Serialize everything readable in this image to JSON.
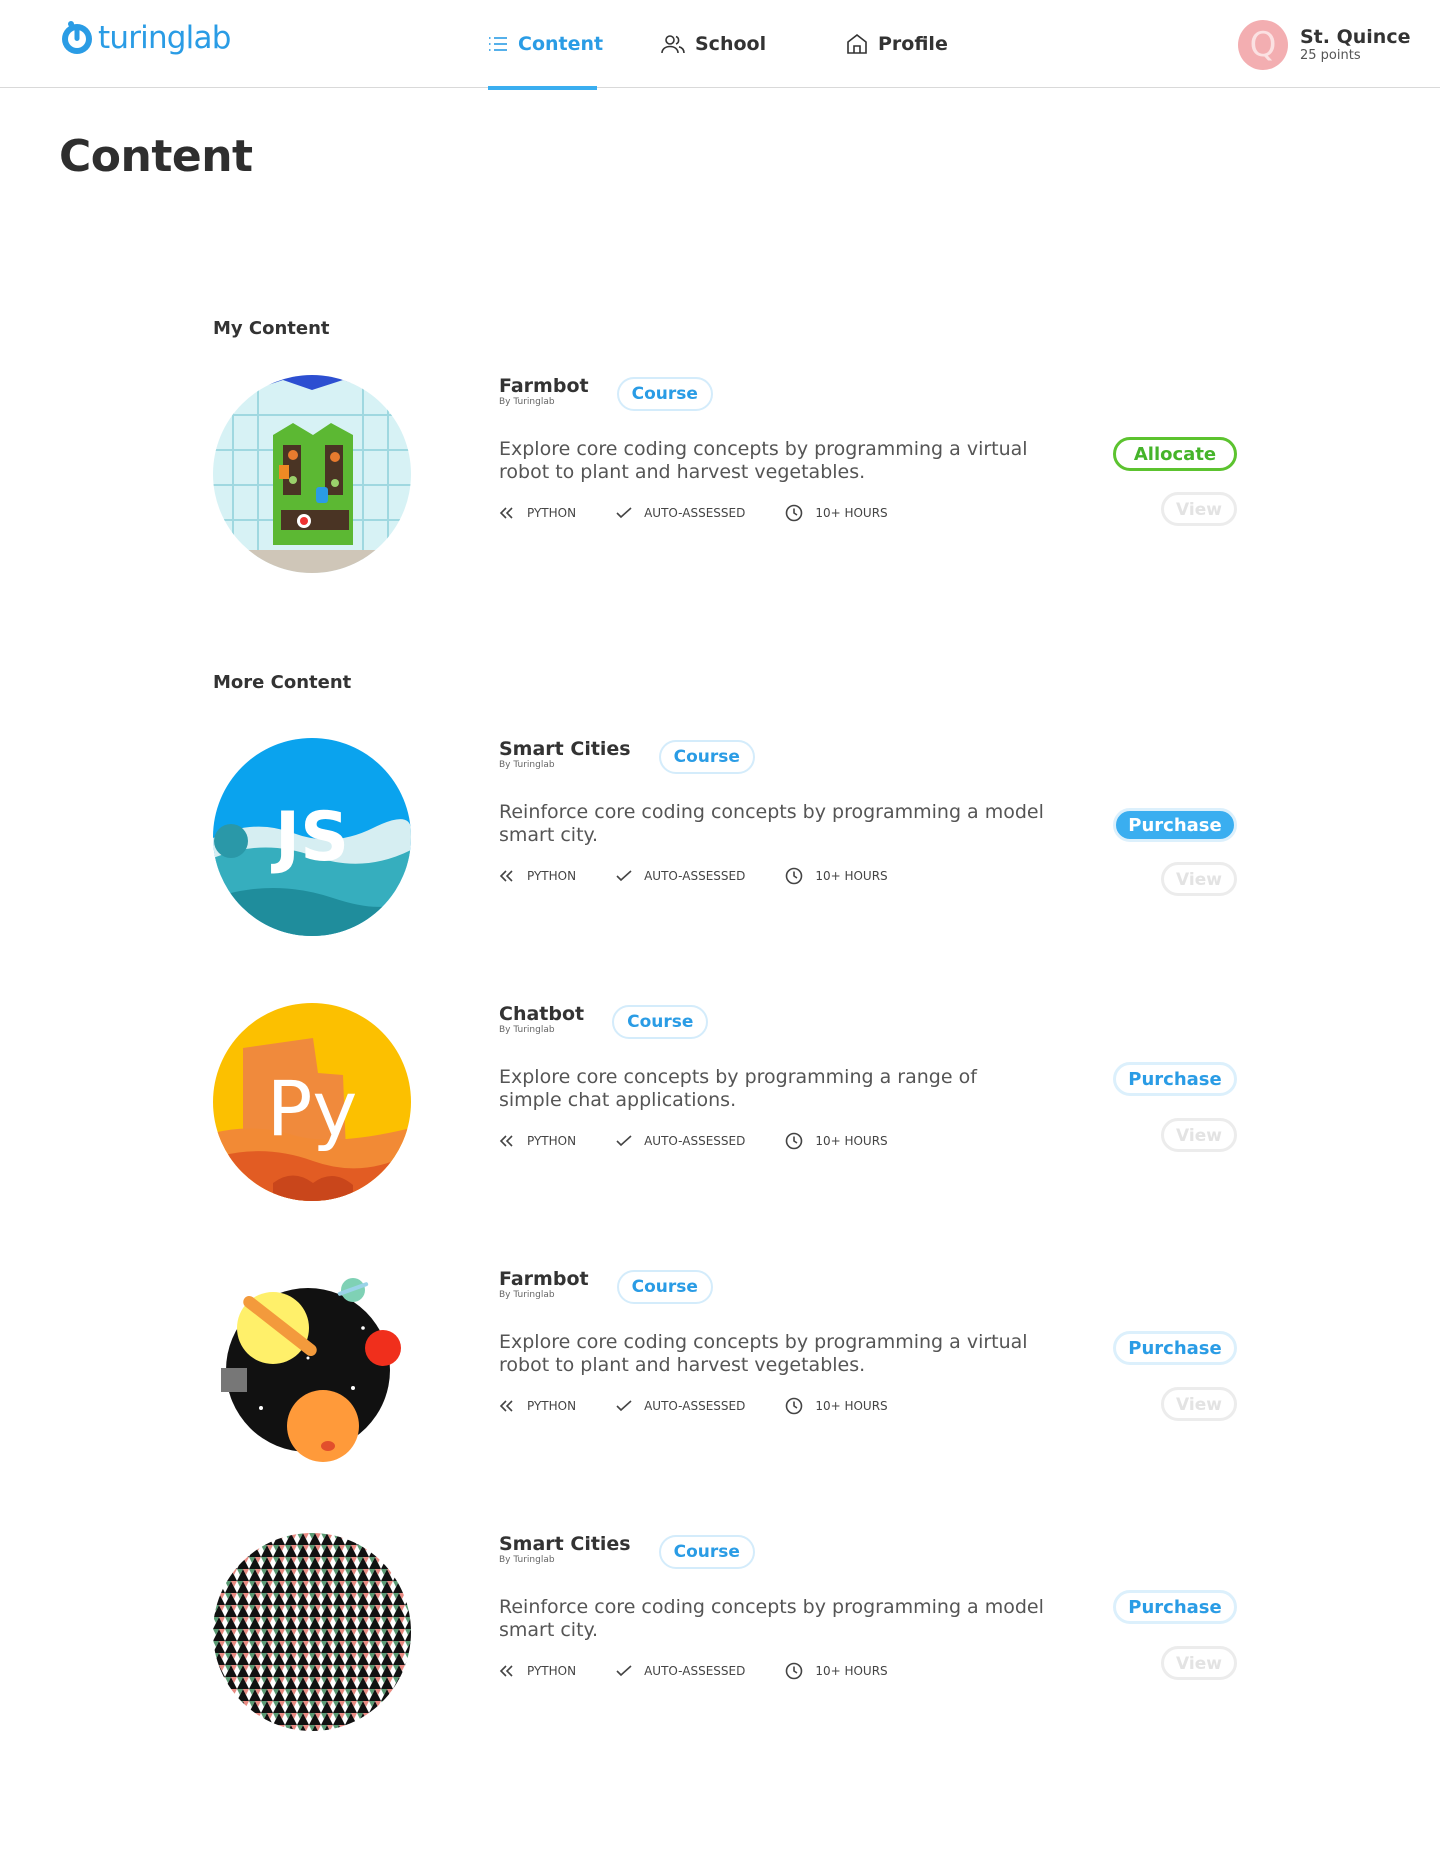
{
  "brand": {
    "name": "turinglab",
    "color": "#2a9ce5"
  },
  "nav": {
    "items": [
      {
        "label": "Content",
        "icon": "list-icon",
        "active": true
      },
      {
        "label": "School",
        "icon": "users-icon",
        "active": false
      },
      {
        "label": "Profile",
        "icon": "home-icon",
        "active": false
      }
    ]
  },
  "user": {
    "initial": "Q",
    "name": "St. Quince",
    "points": "25 points"
  },
  "page": {
    "title": "Content"
  },
  "sections": {
    "my_content": "My Content",
    "more_content": "More Content"
  },
  "cards": [
    {
      "title": "Farmbot",
      "by": "By Turinglab",
      "badge": "Course",
      "description": "Explore core coding concepts by programming a virtual robot to plant and harvest vegetables.",
      "meta": [
        "PYTHON",
        "AUTO-ASSESSED",
        "10+ HOURS"
      ],
      "primary_action": "Allocate",
      "secondary_action": "View",
      "thumb": "greenhouse"
    },
    {
      "title": "Smart Cities",
      "by": "By Turinglab",
      "badge": "Course",
      "description": "Reinforce core coding concepts by programming a model smart city.",
      "meta": [
        "PYTHON",
        "AUTO-ASSESSED",
        "10+ HOURS"
      ],
      "primary_action": "Purchase",
      "secondary_action": "View",
      "thumb": "js",
      "thumb_text": "JS"
    },
    {
      "title": "Chatbot",
      "by": "By Turinglab",
      "badge": "Course",
      "description": "Explore core concepts by programming a range of simple chat applications.",
      "meta": [
        "PYTHON",
        "AUTO-ASSESSED",
        "10+ HOURS"
      ],
      "primary_action": "Purchase",
      "secondary_action": "View",
      "thumb": "py",
      "thumb_text": "Py"
    },
    {
      "title": "Farmbot",
      "by": "By Turinglab",
      "badge": "Course",
      "description": "Explore core coding concepts by programming a virtual robot to plant and harvest vegetables.",
      "meta": [
        "PYTHON",
        "AUTO-ASSESSED",
        "10+ HOURS"
      ],
      "primary_action": "Purchase",
      "secondary_action": "View",
      "thumb": "space"
    },
    {
      "title": "Smart Cities",
      "by": "By Turinglab",
      "badge": "Course",
      "description": "Reinforce core coding concepts by programming a model smart city.",
      "meta": [
        "PYTHON",
        "AUTO-ASSESSED",
        "10+ HOURS"
      ],
      "primary_action": "Purchase",
      "secondary_action": "View",
      "thumb": "pattern"
    }
  ],
  "colors": {
    "accent": "#3aaef0",
    "allocate_green": "#5cc32f",
    "view_disabled": "#e3e3e3"
  }
}
